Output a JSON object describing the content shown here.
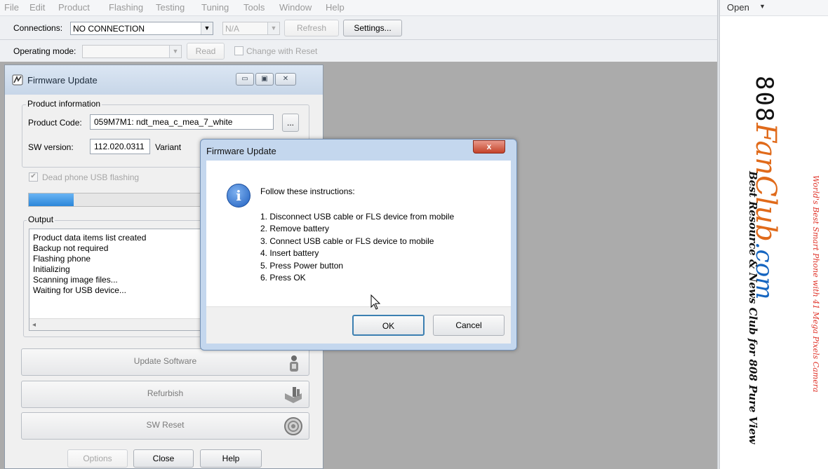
{
  "menu": [
    "File",
    "Edit",
    "Product",
    "Flashing",
    "Testing",
    "Tuning",
    "Tools",
    "Window",
    "Help"
  ],
  "toolbar": {
    "connections_label": "Connections:",
    "connection_value": "NO CONNECTION",
    "port_value": "N/A",
    "refresh_label": "Refresh",
    "settings_label": "Settings...",
    "operating_mode_label": "Operating mode:",
    "operating_mode_value": "",
    "read_label": "Read",
    "change_with_reset_label": "Change with Reset"
  },
  "right_pane": {
    "open_label": "Open",
    "banner": {
      "brand_prefix": "808",
      "brand_name": "FanClub",
      "brand_suffix": ".com",
      "tagline": "Best Resource & News Club for 808 Pure View",
      "top_line": "World's Best Smart Phone with 41 Mega Pixels Camera"
    }
  },
  "fw_window": {
    "title": "Firmware Update",
    "product_info_label": "Product information",
    "product_code_label": "Product Code:",
    "product_code_value": "059M7M1: ndt_mea_c_mea_7_white",
    "browse_label": "...",
    "sw_version_label": "SW version:",
    "sw_version_value": "112.020.0311",
    "variant_label": "Variant",
    "dead_phone_label": "Dead phone USB flashing",
    "progress_fraction": 0.16,
    "output_label": "Output",
    "output_lines": [
      "Product data items list created",
      "Backup not required",
      "Flashing phone",
      "Initializing",
      "Scanning image files...",
      "Waiting for USB device..."
    ],
    "update_software_label": "Update Software",
    "refurbish_label": "Refurbish",
    "sw_reset_label": "SW Reset",
    "options_label": "Options",
    "close_label": "Close",
    "help_label": "Help"
  },
  "dialog": {
    "title": "Firmware Update",
    "close_glyph": "x",
    "info_glyph": "i",
    "heading": "Follow these instructions:",
    "steps": [
      "1. Disconnect USB cable or FLS device from mobile",
      "2. Remove battery",
      "3. Connect USB cable or FLS device to mobile",
      "4. Insert battery",
      "5. Press Power button",
      "6. Press OK"
    ],
    "ok_label": "OK",
    "cancel_label": "Cancel"
  }
}
